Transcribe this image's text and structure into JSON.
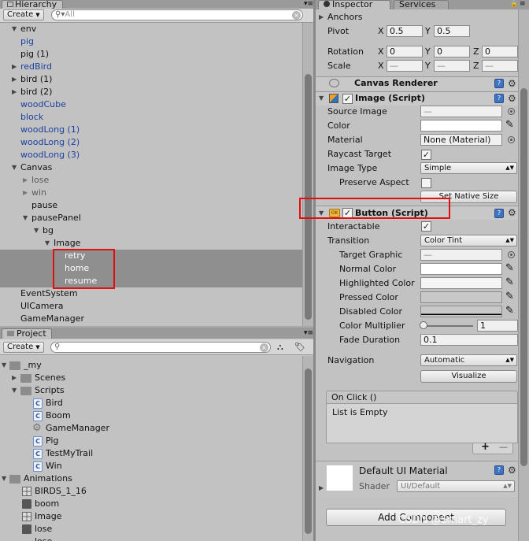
{
  "hierarchy": {
    "tab_label": "Hierarchy",
    "create_label": "Create",
    "search_placeholder": "All",
    "items": [
      {
        "label": "env"
      },
      {
        "label": "pig"
      },
      {
        "label": "pig (1)"
      },
      {
        "label": "redBird"
      },
      {
        "label": "bird (1)"
      },
      {
        "label": "bird (2)"
      },
      {
        "label": "woodCube"
      },
      {
        "label": "block"
      },
      {
        "label": "woodLong (1)"
      },
      {
        "label": "woodLong (2)"
      },
      {
        "label": "woodLong (3)"
      },
      {
        "label": "Canvas"
      },
      {
        "label": "lose"
      },
      {
        "label": "win"
      },
      {
        "label": "pause"
      },
      {
        "label": "pausePanel"
      },
      {
        "label": "bg"
      },
      {
        "label": "Image"
      },
      {
        "label": "retry"
      },
      {
        "label": "home"
      },
      {
        "label": "resume"
      },
      {
        "label": "EventSystem"
      },
      {
        "label": "UICamera"
      },
      {
        "label": "GameManager"
      }
    ]
  },
  "project": {
    "tab_label": "Project",
    "create_label": "Create",
    "items": [
      {
        "label": "_my"
      },
      {
        "label": "Scenes"
      },
      {
        "label": "Scripts"
      },
      {
        "label": "Bird"
      },
      {
        "label": "Boom"
      },
      {
        "label": "GameManager"
      },
      {
        "label": "Pig"
      },
      {
        "label": "TestMyTrail"
      },
      {
        "label": "Win"
      },
      {
        "label": "Animations"
      },
      {
        "label": "BIRDS_1_16"
      },
      {
        "label": "boom"
      },
      {
        "label": "Image"
      },
      {
        "label": "lose"
      },
      {
        "label": "lose"
      }
    ]
  },
  "inspector": {
    "tab_label": "Inspector",
    "services_tab_label": "Services",
    "anchors_label": "Anchors",
    "pivot_label": "Pivot",
    "pivot_x": "0.5",
    "pivot_y": "0.5",
    "rotation_label": "Rotation",
    "rotation_x": "0",
    "rotation_y": "0",
    "rotation_z": "0",
    "scale_label": "Scale",
    "scale_x": "—",
    "scale_y": "—",
    "scale_z": "—",
    "axis_x": "X",
    "axis_y": "Y",
    "axis_z": "Z",
    "canvas_renderer_title": "Canvas Renderer",
    "image_script": {
      "title": "Image (Script)",
      "source_image_label": "Source Image",
      "source_image_value": "—",
      "color_label": "Color",
      "material_label": "Material",
      "material_value": "None (Material)",
      "raycast_label": "Raycast Target",
      "image_type_label": "Image Type",
      "image_type_value": "Simple",
      "preserve_label": "Preserve Aspect",
      "set_native_label": "Set Native Size"
    },
    "button_script": {
      "title": "Button (Script)",
      "interactable_label": "Interactable",
      "transition_label": "Transition",
      "transition_value": "Color Tint",
      "target_graphic_label": "Target Graphic",
      "target_graphic_value": "—",
      "normal_color_label": "Normal Color",
      "highlighted_color_label": "Highlighted Color",
      "pressed_color_label": "Pressed Color",
      "disabled_color_label": "Disabled Color",
      "color_multiplier_label": "Color Multiplier",
      "color_multiplier_value": "1",
      "fade_duration_label": "Fade Duration",
      "fade_duration_value": "0.1",
      "navigation_label": "Navigation",
      "navigation_value": "Automatic",
      "visualize_label": "Visualize",
      "onclick_title": "On Click ()",
      "onclick_empty": "List is Empty",
      "plus": "+",
      "minus": "—"
    },
    "material": {
      "title": "Default UI Material",
      "shader_label": "Shader",
      "shader_value": "UI/Default"
    },
    "add_component_label": "Add Component",
    "watermark": "CSDN @Smart_zy"
  },
  "colors": {
    "selection_band": "#8f8f8f",
    "highlight_box": "#e01010",
    "prefab_blue": "#1c3fa0"
  }
}
